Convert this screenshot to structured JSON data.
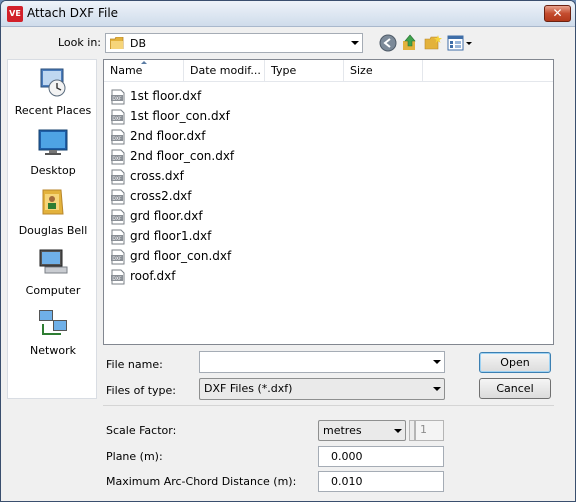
{
  "window": {
    "title": "Attach DXF File",
    "close_glyph": "✕"
  },
  "app_icon_text": "VE",
  "lookin": {
    "label": "Look in:",
    "value": "DB"
  },
  "places": [
    {
      "label": "Recent Places",
      "icon": "recent-places-icon"
    },
    {
      "label": "Desktop",
      "icon": "desktop-icon"
    },
    {
      "label": "Douglas Bell",
      "icon": "user-folder-icon"
    },
    {
      "label": "Computer",
      "icon": "computer-icon"
    },
    {
      "label": "Network",
      "icon": "network-icon"
    }
  ],
  "columns": [
    "Name",
    "Date modif...",
    "Type",
    "Size"
  ],
  "files": [
    "1st floor.dxf",
    "1st floor_con.dxf",
    "2nd floor.dxf",
    "2nd floor_con.dxf",
    "cross.dxf",
    "cross2.dxf",
    "grd floor.dxf",
    "grd floor1.dxf",
    "grd floor_con.dxf",
    "roof.dxf"
  ],
  "file_icon_text": "DXF",
  "filename": {
    "label": "File name:",
    "value": ""
  },
  "filetype": {
    "label": "Files of type:",
    "value": "DXF Files (*.dxf)"
  },
  "buttons": {
    "open": "Open",
    "cancel": "Cancel"
  },
  "scale_factor": {
    "label": "Scale Factor:",
    "unit": "metres",
    "value": "1"
  },
  "plane": {
    "label": "Plane (m):",
    "value": "0.000"
  },
  "arc_chord": {
    "label": "Maximum Arc-Chord Distance (m):",
    "value": "0.010"
  }
}
